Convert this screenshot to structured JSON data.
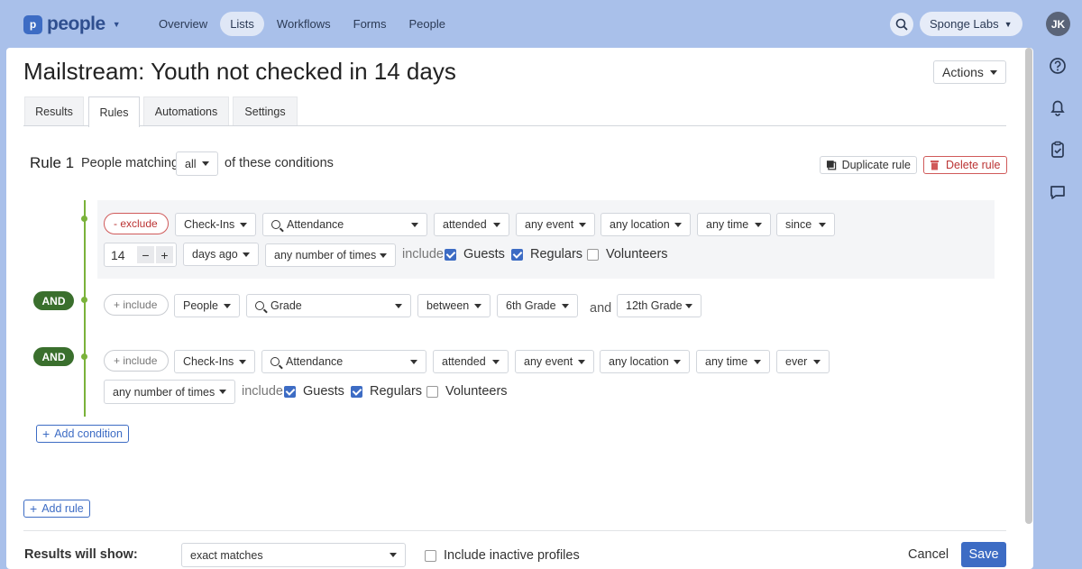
{
  "brand": {
    "logo_letter": "p",
    "name": "people"
  },
  "nav": {
    "items": [
      "Overview",
      "Lists",
      "Workflows",
      "Forms",
      "People"
    ],
    "active": "Lists"
  },
  "org": {
    "name": "Sponge Labs"
  },
  "user": {
    "initials": "JK"
  },
  "page": {
    "title": "Mailstream: Youth not checked in 14 days",
    "actions_label": "Actions"
  },
  "tabs": [
    "Results",
    "Rules",
    "Automations",
    "Settings"
  ],
  "active_tab": "Rules",
  "rule": {
    "label": "Rule 1",
    "matching_prefix": "People matching",
    "matching_value": "all",
    "matching_suffix": "of these conditions",
    "duplicate_label": "Duplicate rule",
    "delete_label": "Delete rule"
  },
  "conditions": [
    {
      "mode": "- exclude",
      "source": "Check-Ins",
      "field": "Attendance",
      "op": "attended",
      "event": "any event",
      "location": "any location",
      "time": "any time",
      "since": "since",
      "amount": "14",
      "unit": "days ago",
      "times": "any number of times",
      "include_label": "include",
      "guests": "Guests",
      "regulars": "Regulars",
      "volunteers": "Volunteers",
      "guests_checked": true,
      "regulars_checked": true,
      "volunteers_checked": false
    },
    {
      "connector": "AND",
      "mode": "+ include",
      "source": "People",
      "field": "Grade",
      "op": "between",
      "from": "6th Grade",
      "and_label": "and",
      "to": "12th Grade"
    },
    {
      "connector": "AND",
      "mode": "+ include",
      "source": "Check-Ins",
      "field": "Attendance",
      "op": "attended",
      "event": "any event",
      "location": "any location",
      "time": "any time",
      "since": "ever",
      "times": "any number of times",
      "include_label": "include",
      "guests": "Guests",
      "regulars": "Regulars",
      "volunteers": "Volunteers",
      "guests_checked": true,
      "regulars_checked": true,
      "volunteers_checked": false
    }
  ],
  "add_condition_label": "Add condition",
  "add_rule_label": "Add rule",
  "footer": {
    "results_label": "Results will show:",
    "results_value": "exact matches",
    "inactive_label": "Include inactive profiles",
    "cancel_label": "Cancel",
    "save_label": "Save"
  },
  "colors": {
    "background": "#a9c0ea",
    "accent": "#3d6cc4",
    "and_badge": "#3a6f2d",
    "connector_line": "#7ab23a",
    "delete": "#d05a5a"
  }
}
